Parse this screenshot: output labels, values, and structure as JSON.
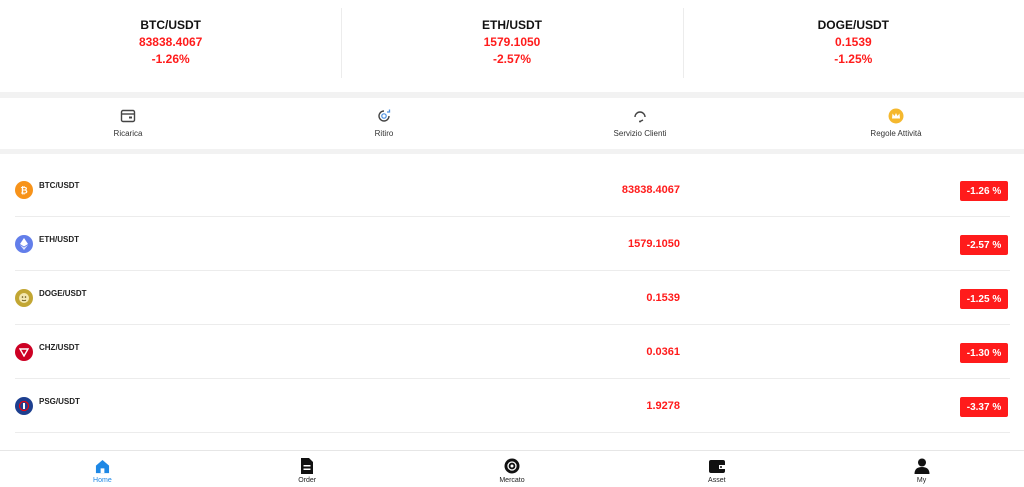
{
  "tickers": [
    {
      "symbol": "BTC/USDT",
      "price": "83838.4067",
      "change": "-1.26%"
    },
    {
      "symbol": "ETH/USDT",
      "price": "1579.1050",
      "change": "-2.57%"
    },
    {
      "symbol": "DOGE/USDT",
      "price": "0.1539",
      "change": "-1.25%"
    }
  ],
  "actions": [
    {
      "label": "Ricarica",
      "icon": "wallet-icon"
    },
    {
      "label": "Ritiro",
      "icon": "withdraw-icon"
    },
    {
      "label": "Servizio Clienti",
      "icon": "headset-icon"
    },
    {
      "label": "Regole Attività",
      "icon": "crown-icon"
    }
  ],
  "markets": [
    {
      "symbol": "BTC/USDT",
      "price": "83838.4067",
      "change": "-1.26 %",
      "icon": "bitcoin-icon",
      "color": "#f7931a"
    },
    {
      "symbol": "ETH/USDT",
      "price": "1579.1050",
      "change": "-2.57 %",
      "icon": "ethereum-icon",
      "color": "#627eea"
    },
    {
      "symbol": "DOGE/USDT",
      "price": "0.1539",
      "change": "-1.25 %",
      "icon": "dogecoin-icon",
      "color": "#c2a633"
    },
    {
      "symbol": "CHZ/USDT",
      "price": "0.0361",
      "change": "-1.30 %",
      "icon": "chiliz-icon",
      "color": "#cd0124"
    },
    {
      "symbol": "PSG/USDT",
      "price": "1.9278",
      "change": "-3.37 %",
      "icon": "psg-icon",
      "color": "#1d3f8f"
    }
  ],
  "tabs": [
    {
      "label": "Home",
      "icon": "home-icon",
      "active": true
    },
    {
      "label": "Order",
      "icon": "document-icon"
    },
    {
      "label": "Mercato",
      "icon": "market-icon"
    },
    {
      "label": "Asset",
      "icon": "wallet-icon"
    },
    {
      "label": "My",
      "icon": "user-icon"
    }
  ],
  "colors": {
    "down": "#ff1b1b",
    "accent": "#1e88e5"
  }
}
